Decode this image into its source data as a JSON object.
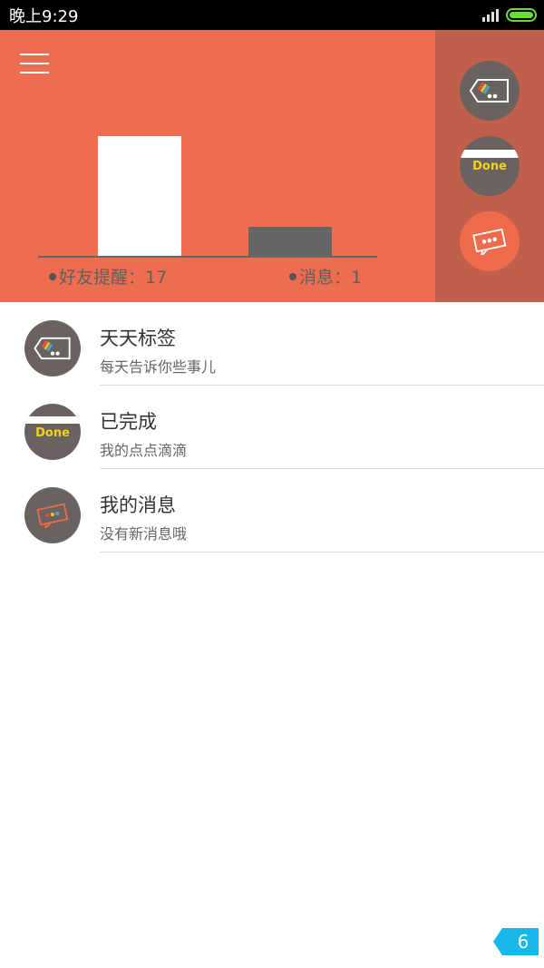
{
  "status_bar": {
    "time": "晚上9:29"
  },
  "chart_data": {
    "type": "bar",
    "categories": [
      "好友提醒",
      "消息"
    ],
    "values": [
      17,
      1
    ],
    "colors": [
      "#ffffff",
      "#666666"
    ],
    "labels": [
      "好友提醒：17",
      "消息：1"
    ]
  },
  "side_icons": [
    {
      "icon": "tag-icon"
    },
    {
      "icon": "done-icon",
      "text": "Done"
    },
    {
      "icon": "message-icon"
    }
  ],
  "list": [
    {
      "title": "天天标签",
      "subtitle": "每天告诉你些事儿",
      "icon": "tag-icon"
    },
    {
      "title": "已完成",
      "subtitle": "我的点点滴滴",
      "icon": "done-icon",
      "done_text": "Done"
    },
    {
      "title": "我的消息",
      "subtitle": "没有新消息哦",
      "icon": "message-icon"
    }
  ],
  "badge": {
    "label": "6",
    "color": "#17b7ea"
  },
  "colors": {
    "header": "#ee6c4f",
    "side_panel": "#c0604c",
    "circle": "#6a625f"
  }
}
